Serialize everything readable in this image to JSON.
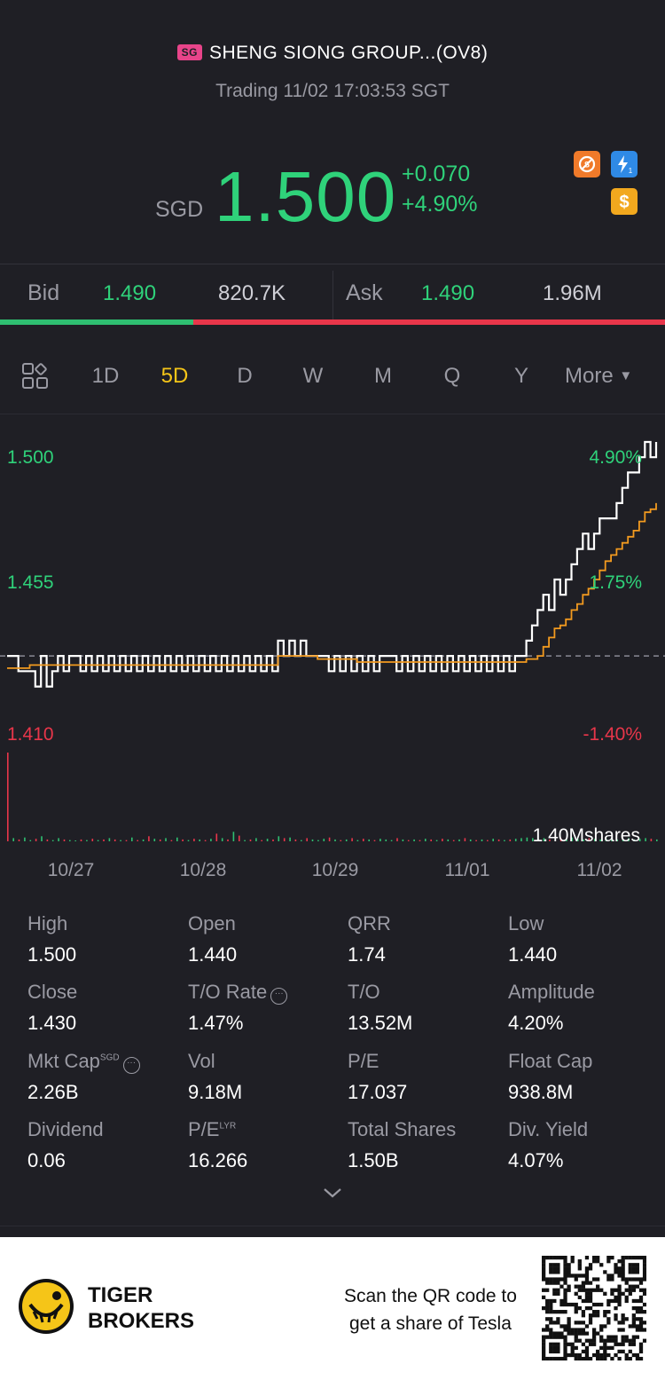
{
  "header": {
    "market_badge": "SG",
    "title": "SHENG SIONG GROUP...(OV8)",
    "status": "Trading 11/02 17:03:53 SGT"
  },
  "quote": {
    "currency": "SGD",
    "price": "1.500",
    "change": "+0.070",
    "change_pct": "+4.90%",
    "up_color": "#2fd27a",
    "down_color": "#e8364a"
  },
  "badges": [
    "no-short-icon",
    "flash-icon",
    "dollar-icon"
  ],
  "bidask": {
    "bid_label": "Bid",
    "bid_price": "1.490",
    "bid_size": "820.7K",
    "ask_label": "Ask",
    "ask_price": "1.490",
    "ask_size": "1.96M",
    "bid_ratio": 0.29
  },
  "tabs": {
    "items": [
      "1D",
      "5D",
      "D",
      "W",
      "M",
      "Q",
      "Y",
      "More"
    ],
    "active": "5D"
  },
  "chart_data": {
    "type": "line",
    "y_left_labels": [
      "1.500",
      "1.455",
      "1.410"
    ],
    "y_right_labels": [
      "4.90%",
      "1.75%",
      "-1.40%"
    ],
    "ylim": [
      1.41,
      1.5
    ],
    "prev_close": 1.43,
    "x_labels": [
      "10/27",
      "10/28",
      "10/29",
      "11/01",
      "11/02"
    ],
    "volume_label": "1.40Mshares",
    "series": [
      {
        "color": "#ffffff",
        "values": [
          1.43,
          1.43,
          1.425,
          1.425,
          1.425,
          1.42,
          1.43,
          1.42,
          1.425,
          1.43,
          1.425,
          1.43,
          1.43,
          1.425,
          1.43,
          1.425,
          1.43,
          1.425,
          1.43,
          1.425,
          1.43,
          1.425,
          1.43,
          1.425,
          1.43,
          1.425,
          1.43,
          1.425,
          1.43,
          1.425,
          1.43,
          1.425,
          1.43,
          1.425,
          1.43,
          1.425,
          1.43,
          1.425,
          1.43,
          1.425,
          1.43,
          1.425,
          1.43,
          1.425,
          1.43,
          1.425,
          1.43,
          1.425,
          1.435,
          1.43,
          1.435,
          1.43,
          1.435,
          1.43,
          1.43,
          1.43,
          1.43,
          1.425,
          1.43,
          1.425,
          1.43,
          1.425,
          1.43,
          1.425,
          1.43,
          1.425,
          1.43,
          1.43,
          1.43,
          1.425,
          1.43,
          1.425,
          1.43,
          1.425,
          1.43,
          1.425,
          1.43,
          1.425,
          1.43,
          1.425,
          1.43,
          1.425,
          1.43,
          1.425,
          1.43,
          1.425,
          1.43,
          1.425,
          1.43,
          1.425,
          1.43,
          1.43,
          1.435,
          1.44,
          1.445,
          1.45,
          1.445,
          1.455,
          1.45,
          1.455,
          1.46,
          1.465,
          1.47,
          1.465,
          1.47,
          1.475,
          1.475,
          1.475,
          1.48,
          1.485,
          1.49,
          1.49,
          1.495,
          1.5,
          1.495,
          1.5
        ]
      },
      {
        "color": "#f29a1f",
        "values": [
          1.426,
          1.426,
          1.426,
          1.426,
          1.427,
          1.427,
          1.427,
          1.427,
          1.427,
          1.427,
          1.427,
          1.427,
          1.427,
          1.427,
          1.427,
          1.427,
          1.427,
          1.427,
          1.427,
          1.427,
          1.427,
          1.427,
          1.427,
          1.427,
          1.427,
          1.427,
          1.427,
          1.427,
          1.427,
          1.427,
          1.427,
          1.427,
          1.427,
          1.427,
          1.427,
          1.427,
          1.427,
          1.427,
          1.427,
          1.427,
          1.427,
          1.427,
          1.427,
          1.427,
          1.427,
          1.427,
          1.427,
          1.427,
          1.43,
          1.43,
          1.43,
          1.43,
          1.43,
          1.43,
          1.43,
          1.429,
          1.429,
          1.429,
          1.429,
          1.429,
          1.429,
          1.429,
          1.428,
          1.428,
          1.428,
          1.428,
          1.428,
          1.428,
          1.428,
          1.428,
          1.428,
          1.428,
          1.428,
          1.428,
          1.428,
          1.428,
          1.428,
          1.428,
          1.428,
          1.428,
          1.428,
          1.428,
          1.428,
          1.428,
          1.428,
          1.428,
          1.428,
          1.428,
          1.428,
          1.428,
          1.428,
          1.428,
          1.429,
          1.429,
          1.43,
          1.433,
          1.436,
          1.439,
          1.44,
          1.442,
          1.445,
          1.447,
          1.45,
          1.452,
          1.455,
          1.458,
          1.461,
          1.463,
          1.465,
          1.467,
          1.469,
          1.471,
          1.474,
          1.477,
          1.478,
          1.48
        ]
      }
    ],
    "volume": [
      1.4,
      0.05,
      0.03,
      0.06,
      0.02,
      0.04,
      0.08,
      0.03,
      0.02,
      0.05,
      0.03,
      0.02,
      0.01,
      0.03,
      0.02,
      0.04,
      0.02,
      0.03,
      0.05,
      0.03,
      0.02,
      0.02,
      0.06,
      0.02,
      0.03,
      0.08,
      0.04,
      0.03,
      0.05,
      0.02,
      0.06,
      0.03,
      0.02,
      0.04,
      0.03,
      0.02,
      0.04,
      0.12,
      0.05,
      0.03,
      0.15,
      0.09,
      0.02,
      0.03,
      0.05,
      0.02,
      0.04,
      0.03,
      0.08,
      0.05,
      0.06,
      0.03,
      0.02,
      0.05,
      0.03,
      0.02,
      0.04,
      0.06,
      0.03,
      0.02,
      0.03,
      0.05,
      0.02,
      0.04,
      0.03,
      0.02,
      0.04,
      0.03,
      0.02,
      0.05,
      0.03,
      0.02,
      0.03,
      0.02,
      0.04,
      0.03,
      0.02,
      0.04,
      0.03,
      0.02,
      0.03,
      0.05,
      0.03,
      0.02,
      0.03,
      0.02,
      0.04,
      0.03,
      0.02,
      0.03,
      0.04,
      0.05,
      0.06,
      0.05,
      0.04,
      0.05,
      0.03,
      0.04,
      0.05,
      0.03,
      0.06,
      0.04,
      0.03,
      0.05,
      0.04,
      0.03,
      0.05,
      0.04,
      0.03,
      0.04,
      0.05,
      0.03,
      0.04,
      0.05,
      0.04,
      0.03
    ],
    "volume_max": 1.4
  },
  "stats": [
    {
      "label": "High",
      "value": "1.500"
    },
    {
      "label": "Open",
      "value": "1.440"
    },
    {
      "label": "QRR",
      "value": "1.74"
    },
    {
      "label": "Low",
      "value": "1.440"
    },
    {
      "label": "Close",
      "value": "1.430"
    },
    {
      "label": "T/O Rate",
      "value": "1.47%"
    },
    {
      "label": "T/O",
      "value": "13.52M"
    },
    {
      "label": "Amplitude",
      "value": "4.20%"
    },
    {
      "label": "Mkt Cap",
      "value": "2.26B",
      "sup": "SGD"
    },
    {
      "label": "Vol",
      "value": "9.18M"
    },
    {
      "label": "P/E",
      "value": "17.037"
    },
    {
      "label": "Float Cap",
      "value": "938.8M"
    },
    {
      "label": "Dividend",
      "value": "0.06"
    },
    {
      "label": "P/E",
      "value": "16.266",
      "sup": "LYR"
    },
    {
      "label": "Total Shares",
      "value": "1.50B"
    },
    {
      "label": "Div. Yield",
      "value": "4.07%"
    }
  ],
  "footer": {
    "brand_line1": "TIGER",
    "brand_line2": "BROKERS",
    "cta_line1": "Scan the QR code to",
    "cta_line2": "get a share of Tesla"
  }
}
